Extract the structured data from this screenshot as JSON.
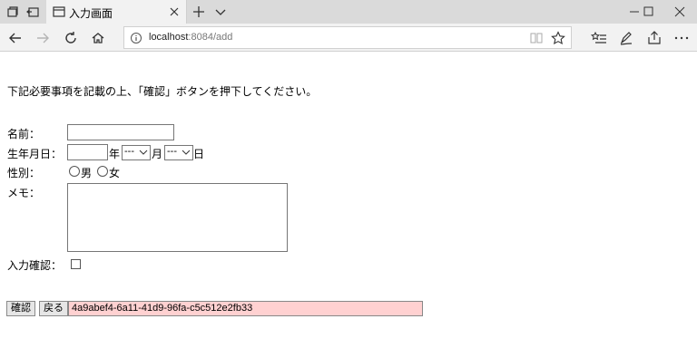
{
  "browser": {
    "tab_title": "入力画面",
    "url_host": "localhost",
    "url_path": ":8084/add"
  },
  "page": {
    "instruction": "下記必要事項を記載の上、「確認」ボタンを押下してください。",
    "form": {
      "name_label": "名前：",
      "name_value": "",
      "birth_label": "生年月日：",
      "birth_year_value": "",
      "year_unit": "年",
      "month_value": "---",
      "month_unit": "月",
      "day_value": "---",
      "day_unit": "日",
      "gender_label": "性別：",
      "gender_options": [
        "男",
        "女"
      ],
      "memo_label": "メモ：",
      "memo_value": "",
      "confirm_label": "入力確認：",
      "confirm_checked": false
    },
    "buttons": {
      "confirm": "確認",
      "back": "戻る"
    },
    "uuid_field": {
      "value": "4a9abef4-6a11-41d9-96fa-c5c512e2fb33",
      "background": "#ffd1d1"
    }
  }
}
